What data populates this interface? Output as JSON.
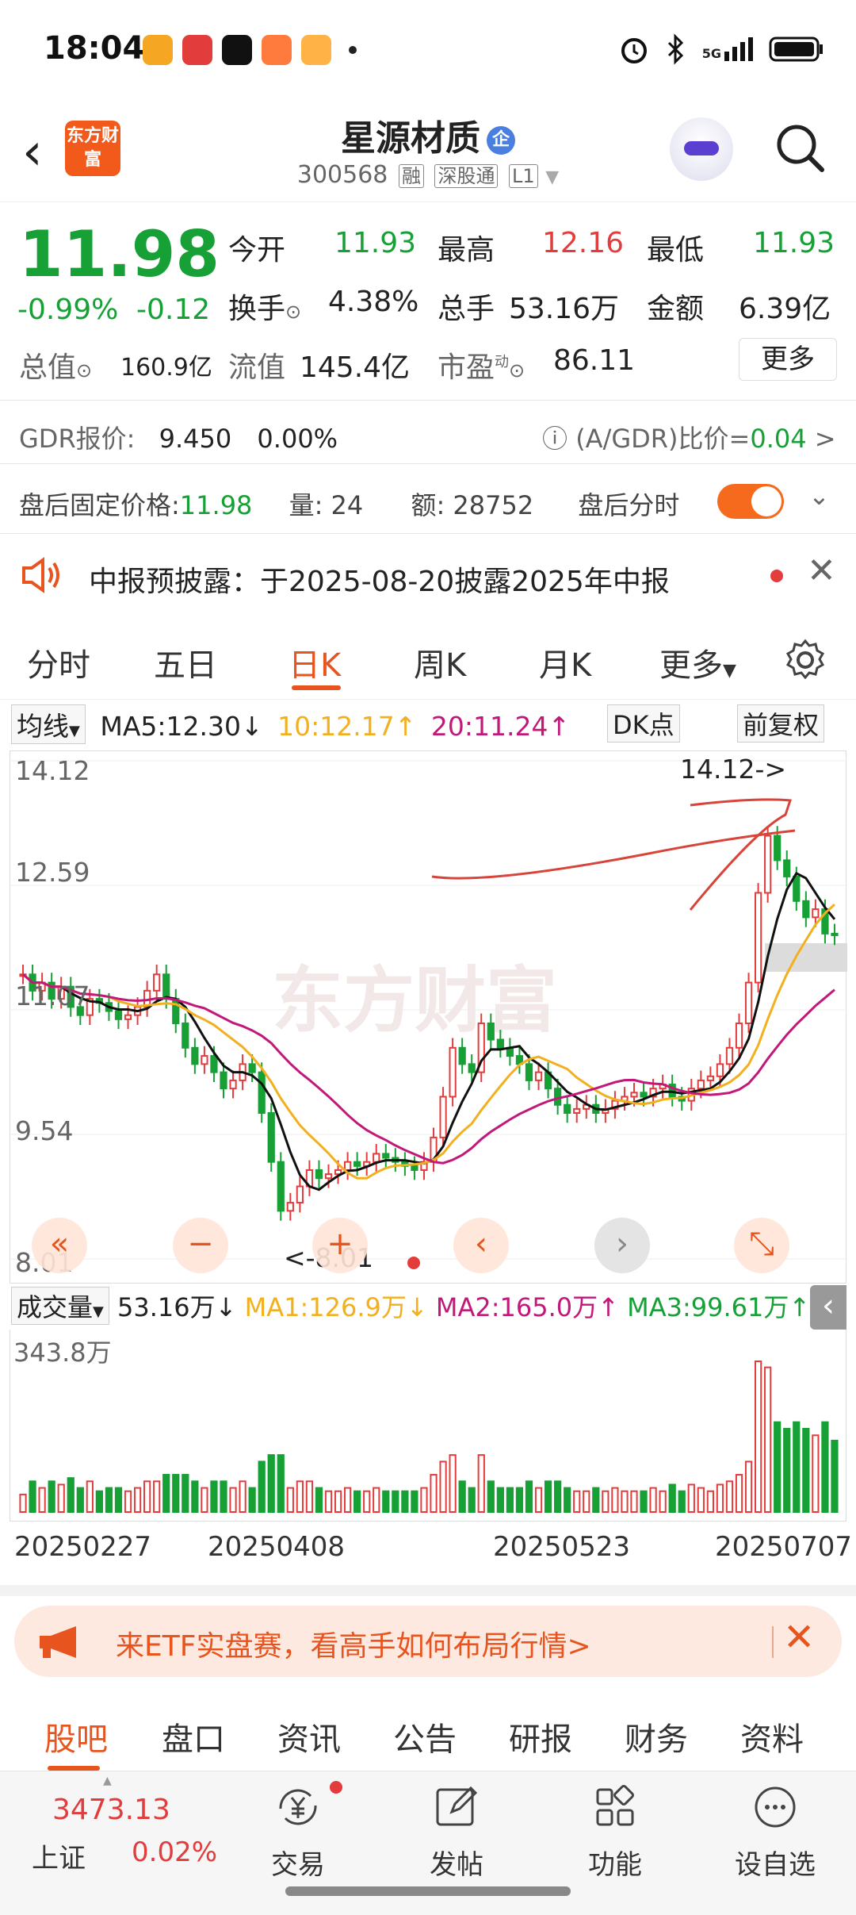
{
  "status_bar": {
    "time": "18:04",
    "network": "5G"
  },
  "header": {
    "logo_text": "东方财富",
    "stock_name": "星源材质",
    "badge": "企",
    "code": "300568",
    "tags": [
      "融",
      "深股通",
      "L1"
    ]
  },
  "quote": {
    "price": "11.98",
    "change_pct": "-0.99%",
    "change": "-0.12",
    "open_label": "今开",
    "open": "11.93",
    "high_label": "最高",
    "high": "12.16",
    "low_label": "最低",
    "low": "11.93",
    "turnover_label": "换手",
    "turnover": "4.38%",
    "volume_label": "总手",
    "volume": "53.16万",
    "amount_label": "金额",
    "amount": "6.39亿",
    "mktcap_label": "总值",
    "mktcap": "160.9亿",
    "float_label": "流值",
    "float": "145.4亿",
    "pe_label": "市盈",
    "pe_sup": "动",
    "pe": "86.11",
    "more_button": "更多"
  },
  "gdr": {
    "label": "GDR报价:",
    "price": "9.450",
    "pct": "0.00%",
    "ratio_label": "(A/GDR)比价=",
    "ratio": "0.04",
    "arrow": ">"
  },
  "after_hours": {
    "label": "盘后固定价格:",
    "price": "11.98",
    "vol_label": "量:",
    "vol": "24",
    "amt_label": "额:",
    "amt": "28752",
    "timeshare_label": "盘后分时",
    "toggle_on": true
  },
  "notice": {
    "text": "中报预披露：于2025-08-20披露2025年中报"
  },
  "chart_tabs": {
    "items": [
      "分时",
      "五日",
      "日K",
      "周K",
      "月K",
      "更多"
    ],
    "active": "日K"
  },
  "ma_bar": {
    "selector": "均线",
    "ma5": "MA5:12.30",
    "ma5_arrow": "↓",
    "ma10": "10:12.17",
    "ma10_arrow": "↑",
    "ma20": "20:11.24",
    "ma20_arrow": "↑",
    "dk": "DK点",
    "adj": "前复权"
  },
  "price_axis": [
    "14.12",
    "12.59",
    "11.07",
    "9.54",
    "8.01"
  ],
  "annotations": {
    "high": "14.12->",
    "low": "<-8.01"
  },
  "watermark": "东方财富",
  "vol_bar": {
    "selector": "成交量",
    "vol": "53.16万",
    "vol_arrow": "↓",
    "ma1": "MA1:126.9万",
    "ma1_arrow": "↓",
    "ma2": "MA2:165.0万",
    "ma2_arrow": "↑",
    "ma3": "MA3:99.61万",
    "ma3_arrow": "↑"
  },
  "vol_axis": "343.8万",
  "dates": [
    "20250227",
    "20250408",
    "20250523",
    "20250707"
  ],
  "banner": {
    "text": "来ETF实盘赛，看高手如何布局行情>"
  },
  "bottom_tabs": {
    "items": [
      "股吧",
      "盘口",
      "资讯",
      "公告",
      "研报",
      "财务",
      "资料"
    ],
    "active": "股吧"
  },
  "footer": {
    "index_value": "3473.13",
    "index_name": "上证",
    "index_pct": "0.02%",
    "items": [
      "交易",
      "发帖",
      "功能",
      "设自选"
    ]
  },
  "colors": {
    "up": "#e23c3c",
    "down": "#16a035",
    "accent": "#e8541e",
    "ma5": "#111111",
    "ma10": "#f2b01e",
    "ma20": "#c2187a"
  },
  "chart_data": {
    "type": "candlestick",
    "ylim": [
      8.01,
      14.12
    ],
    "high_marker": 14.12,
    "low_marker": 8.01,
    "closes": [
      11.5,
      11.3,
      11.4,
      11.2,
      11.35,
      11.1,
      11.0,
      11.2,
      11.15,
      11.05,
      10.95,
      11.0,
      11.1,
      11.3,
      11.5,
      11.2,
      10.9,
      10.6,
      10.4,
      10.5,
      10.3,
      10.1,
      10.2,
      10.4,
      10.3,
      9.8,
      9.2,
      8.6,
      8.7,
      8.9,
      9.1,
      9.0,
      9.05,
      9.1,
      9.2,
      9.15,
      9.2,
      9.3,
      9.25,
      9.2,
      9.15,
      9.1,
      9.2,
      9.5,
      10.0,
      10.6,
      10.4,
      10.3,
      10.9,
      10.7,
      10.6,
      10.5,
      10.4,
      10.2,
      10.3,
      10.1,
      9.9,
      9.8,
      9.85,
      9.9,
      9.8,
      9.85,
      9.95,
      10.0,
      10.05,
      10.0,
      10.1,
      10.15,
      10.0,
      9.95,
      10.1,
      10.2,
      10.25,
      10.4,
      10.6,
      10.9,
      11.4,
      12.5,
      13.2,
      12.9,
      12.7,
      12.4,
      12.2,
      12.3,
      12.0,
      11.98
    ],
    "volume_ylim": [
      0,
      343.8
    ]
  }
}
